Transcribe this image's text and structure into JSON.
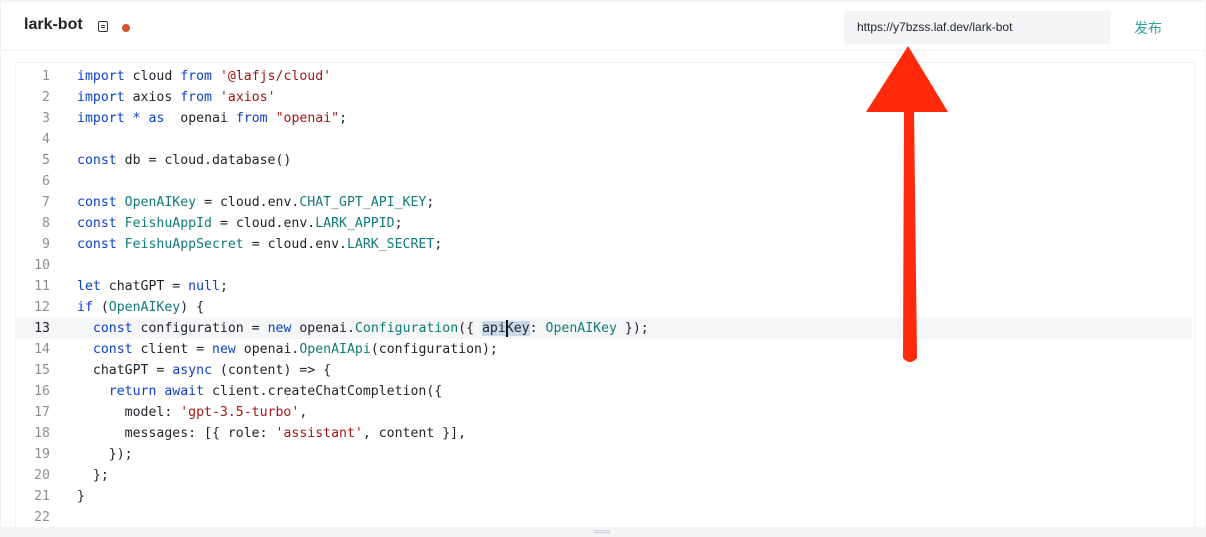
{
  "header": {
    "file_name": "lark-bot",
    "url": "https://y7bzss.laf.dev/lark-bot",
    "publish_label": "发布"
  },
  "editor": {
    "current_line": 13,
    "lines": [
      {
        "n": "1",
        "code": "import cloud from '@lafjs/cloud'"
      },
      {
        "n": "2",
        "code": "import axios from 'axios'"
      },
      {
        "n": "3",
        "code": "import * as  openai from \"openai\";"
      },
      {
        "n": "4",
        "code": ""
      },
      {
        "n": "5",
        "code": "const db = cloud.database()"
      },
      {
        "n": "6",
        "code": ""
      },
      {
        "n": "7",
        "code": "const OpenAIKey = cloud.env.CHAT_GPT_API_KEY;"
      },
      {
        "n": "8",
        "code": "const FeishuAppId = cloud.env.LARK_APPID;"
      },
      {
        "n": "9",
        "code": "const FeishuAppSecret = cloud.env.LARK_SECRET;"
      },
      {
        "n": "10",
        "code": ""
      },
      {
        "n": "11",
        "code": "let chatGPT = null;"
      },
      {
        "n": "12",
        "code": "if (OpenAIKey) {"
      },
      {
        "n": "13",
        "code": "  const configuration = new openai.Configuration({ apiKey: OpenAIKey });"
      },
      {
        "n": "14",
        "code": "  const client = new openai.OpenAIApi(configuration);"
      },
      {
        "n": "15",
        "code": "  chatGPT = async (content) => {"
      },
      {
        "n": "16",
        "code": "    return await client.createChatCompletion({"
      },
      {
        "n": "17",
        "code": "      model: 'gpt-3.5-turbo',"
      },
      {
        "n": "18",
        "code": "      messages: [{ role: 'assistant', content }],"
      },
      {
        "n": "19",
        "code": "    });"
      },
      {
        "n": "20",
        "code": "  };"
      },
      {
        "n": "21",
        "code": "}"
      },
      {
        "n": "22",
        "code": ""
      }
    ]
  },
  "colors": {
    "keyword": "#0b40c9",
    "string": "#a31515",
    "identifier": "#117a7a",
    "publish": "#2fa39a",
    "arrow": "#ff2a0a",
    "unsaved_dot": "#d3542d"
  },
  "icons": [
    "document-icon",
    "unsaved-dot",
    "red-arrow-annotation"
  ]
}
